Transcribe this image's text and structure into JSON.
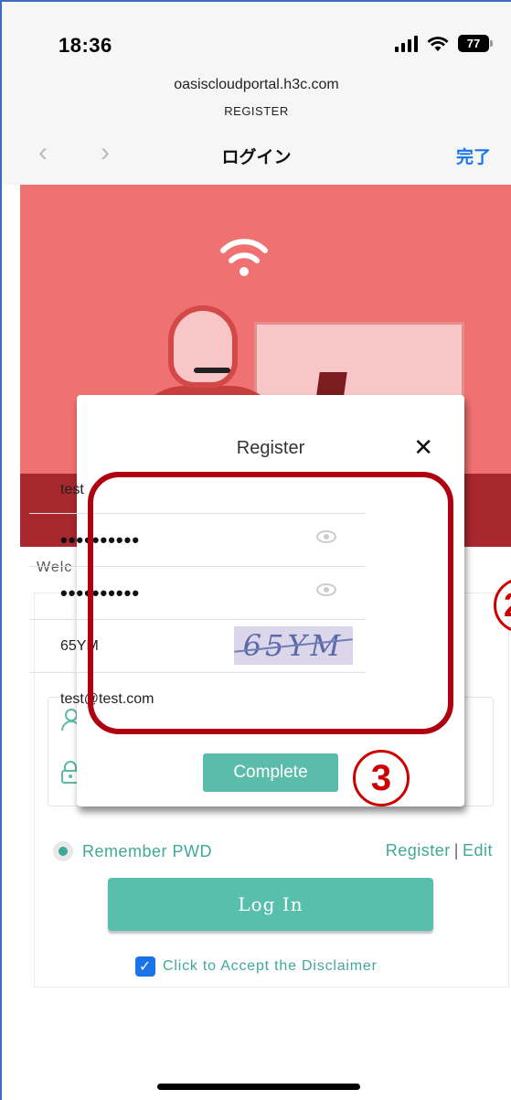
{
  "status_bar": {
    "time": "18:36",
    "battery": "77"
  },
  "browser": {
    "url": "oasiscloudportal.h3c.com",
    "page_subtitle": "REGISTER",
    "back_glyph": "‹",
    "forward_glyph": "›",
    "title": "ログイン",
    "done_label": "完了"
  },
  "login_page": {
    "welcome_text": "Welc",
    "remember_label": "Remember PWD",
    "register_link": "Register",
    "separator": "|",
    "edit_link": "Edit",
    "login_button": "Log In",
    "disclaimer_label": "Click to Accept the Disclaimer"
  },
  "register_modal": {
    "title": "Register",
    "close_glyph": "✕",
    "username_value": "test",
    "password_value": "••••••••••",
    "confirm_password_value": "••••••••••",
    "captcha_input_value": "65YM",
    "captcha_image_text": "65YM",
    "email_value": "test@test.com",
    "complete_button": "Complete"
  },
  "annotations": {
    "step_2": "2",
    "step_3": "3"
  },
  "colors": {
    "accent": "#58bfac",
    "hero": "#f07171",
    "annotation": "#b00010",
    "link": "#1a73e8"
  }
}
